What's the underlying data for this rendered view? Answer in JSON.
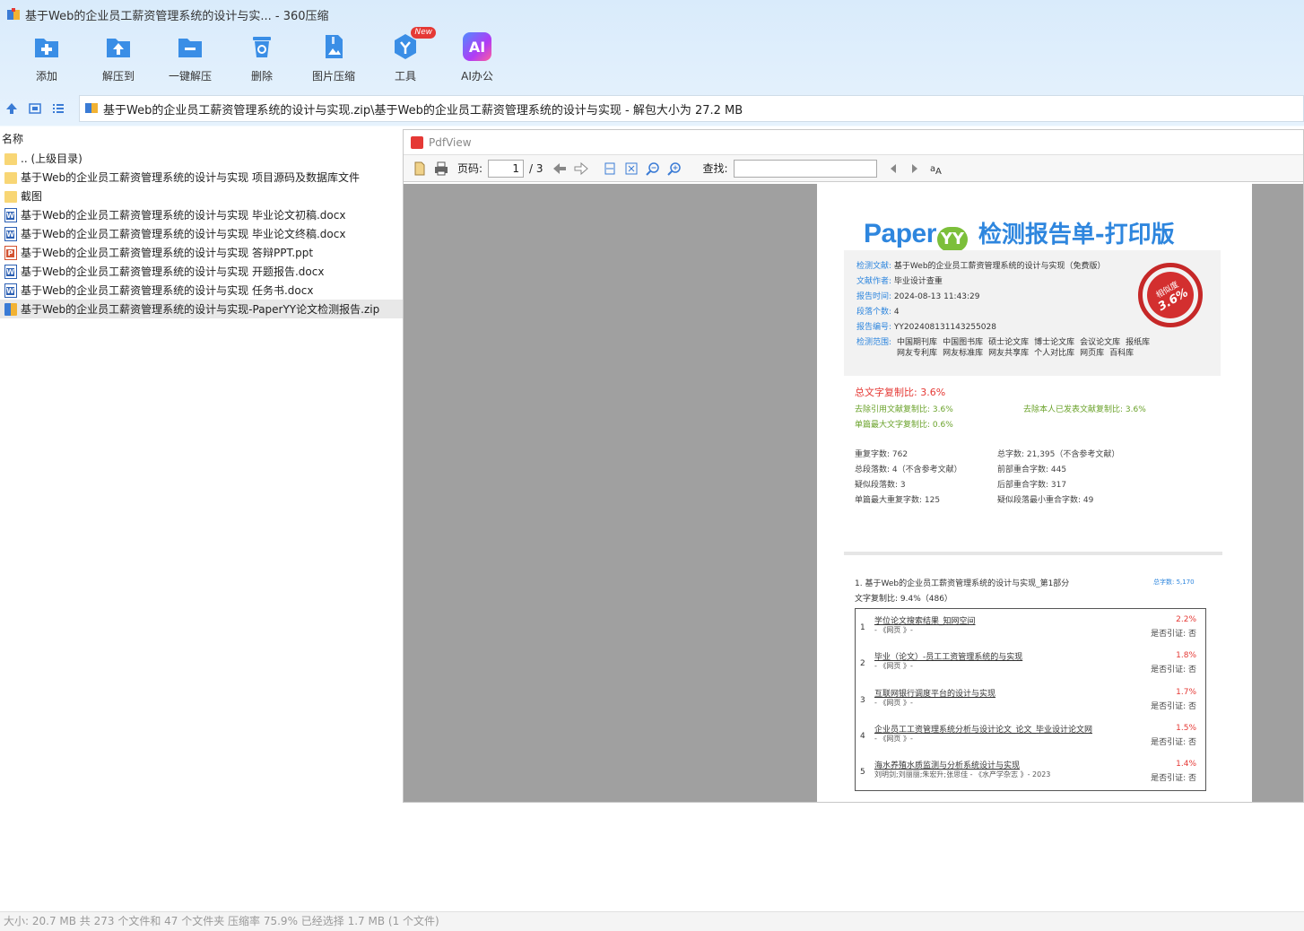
{
  "window": {
    "title": "基于Web的企业员工薪资管理系统的设计与实... - 360压缩"
  },
  "toolbar": [
    {
      "label": "添加",
      "icon": "add-icon",
      "color": "#3a8ee6"
    },
    {
      "label": "解压到",
      "icon": "extract-to-icon",
      "color": "#3a8ee6"
    },
    {
      "label": "一键解压",
      "icon": "one-click-extract-icon",
      "color": "#3a8ee6"
    },
    {
      "label": "删除",
      "icon": "delete-icon",
      "color": "#3a8ee6"
    },
    {
      "label": "图片压缩",
      "icon": "image-compress-icon",
      "color": "#3a8ee6"
    },
    {
      "label": "工具",
      "icon": "tools-icon",
      "color": "#3a8ee6",
      "badge": "New"
    },
    {
      "label": "AI办公",
      "icon": "ai-office-icon",
      "color": "#7b5cf5",
      "glyph": "AI"
    }
  ],
  "address": {
    "path": "基于Web的企业员工薪资管理系统的设计与实现.zip\\基于Web的企业员工薪资管理系统的设计与实现 - 解包大小为 27.2 MB"
  },
  "filelist": {
    "header": "名称",
    "rows": [
      {
        "name": ".. (上级目录)",
        "type": "folder"
      },
      {
        "name": "基于Web的企业员工薪资管理系统的设计与实现 项目源码及数据库文件",
        "type": "folder"
      },
      {
        "name": "截图",
        "type": "folder"
      },
      {
        "name": "基于Web的企业员工薪资管理系统的设计与实现 毕业论文初稿.docx",
        "type": "docx"
      },
      {
        "name": "基于Web的企业员工薪资管理系统的设计与实现 毕业论文终稿.docx",
        "type": "docx"
      },
      {
        "name": "基于Web的企业员工薪资管理系统的设计与实现 答辩PPT.ppt",
        "type": "ppt"
      },
      {
        "name": "基于Web的企业员工薪资管理系统的设计与实现 开题报告.docx",
        "type": "docx"
      },
      {
        "name": "基于Web的企业员工薪资管理系统的设计与实现 任务书.docx",
        "type": "docx"
      },
      {
        "name": "基于Web的企业员工薪资管理系统的设计与实现-PaperYY论文检测报告.zip",
        "type": "zip",
        "selected": true
      }
    ]
  },
  "pdfview": {
    "title": "PdfView",
    "page_label": "页码:",
    "page_current": "1",
    "page_total": "/ 3",
    "find_label": "查找:",
    "doc": {
      "brand": "Paper",
      "brand_mark": "YY",
      "brand_sub": "检测报告单-打印版",
      "info": [
        {
          "key": "检测文献:",
          "value": "基于Web的企业员工薪资管理系统的设计与实现（免费版）"
        },
        {
          "key": "文献作者:",
          "value": "毕业设计查重"
        },
        {
          "key": "报告时间:",
          "value": "2024-08-13 11:43:29"
        },
        {
          "key": "段落个数:",
          "value": "4"
        },
        {
          "key": "报告编号:",
          "value": "YY202408131143255028"
        }
      ],
      "range_key": "检测范围:",
      "ranges": [
        "中国期刊库",
        "中国图书库",
        "硕士论文库",
        "博士论文库",
        "会议论文库",
        "报纸库",
        "网友专利库",
        "网友标准库",
        "网友共享库",
        "个人对比库",
        "网页库",
        "百科库"
      ],
      "seal_text": "相似度",
      "seal_value": "3.6%",
      "total_ratio": "总文字复制比: 3.6%",
      "metric_excl_cite": "去除引用文献复制比: 3.6%",
      "metric_excl_self": "去除本人已发表文献复制比: 3.6%",
      "metric_max": "单篇最大文字复制比: 0.6%",
      "stats_left": [
        "重复字数: 762",
        "总段落数: 4（不含参考文献）",
        "疑似段落数: 3",
        "单篇最大重复字数: 125"
      ],
      "stats_right": [
        "总字数: 21,395（不含参考文献）",
        "前部重合字数: 445",
        "后部重合字数: 317",
        "疑似段落最小重合字数: 49"
      ],
      "section_title": "1. 基于Web的企业员工薪资管理系统的设计与实现_第1部分",
      "section_total": "总字数: 5,170",
      "section_ratio": "文字复制比: 9.4%（486）",
      "sources": [
        {
          "num": "1",
          "title": "学位论文搜索结果_知网空间",
          "meta": "- 《网页 》-",
          "pct": "2.2%",
          "cite": "是否引证: 否"
        },
        {
          "num": "2",
          "title": "毕业（论文）-员工工资管理系统的与实现",
          "meta": "- 《网页 》-",
          "pct": "1.8%",
          "cite": "是否引证: 否"
        },
        {
          "num": "3",
          "title": "互联网银行调度平台的设计与实现",
          "meta": "- 《网页 》-",
          "pct": "1.7%",
          "cite": "是否引证: 否"
        },
        {
          "num": "4",
          "title": "企业员工工资管理系统分析与设计论文_论文_毕业设计论文网",
          "meta": "- 《网页 》-",
          "pct": "1.5%",
          "cite": "是否引证: 否"
        },
        {
          "num": "5",
          "title": "海水养殖水质监测与分析系统设计与实现",
          "meta": "刘明剑;刘丽丽;朱宏升;张思佳 - 《水产学杂志 》- 2023",
          "pct": "1.4%",
          "cite": "是否引证: 否"
        }
      ]
    }
  },
  "status": {
    "text": "大小: 20.7 MB 共 273 个文件和 47 个文件夹 压缩率 75.9% 已经选择 1.7 MB (1 个文件)"
  }
}
